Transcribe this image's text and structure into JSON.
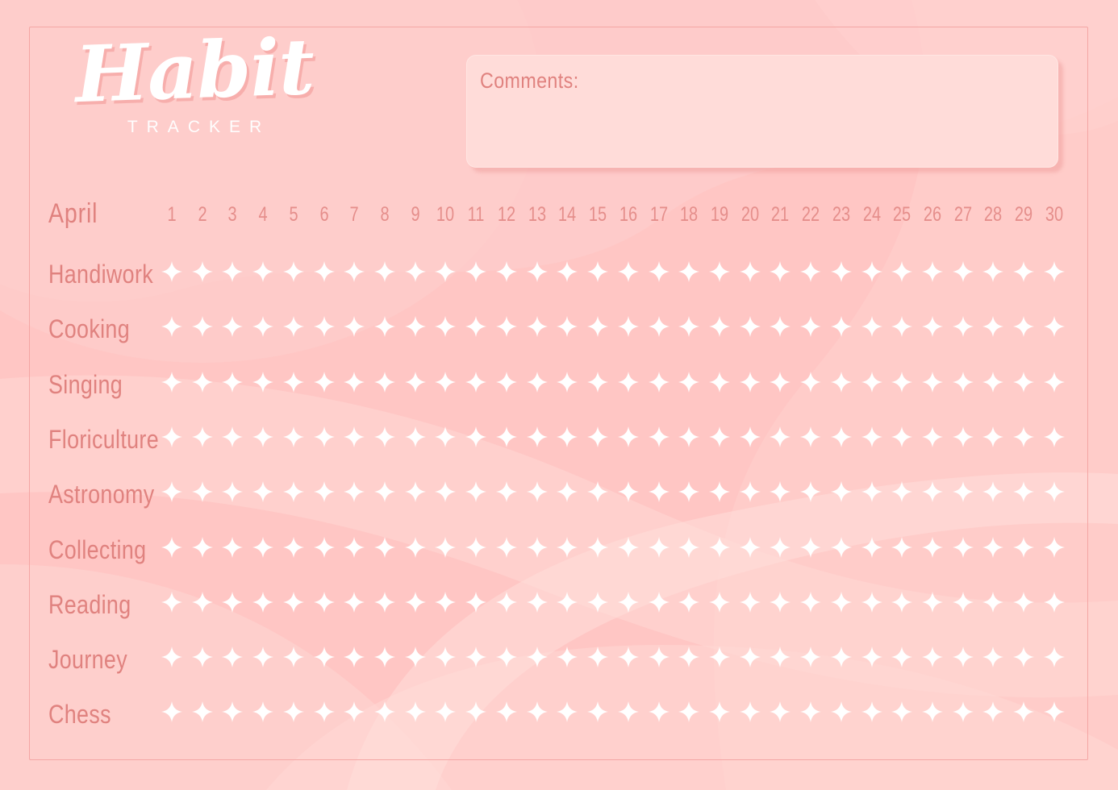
{
  "document": {
    "title_main": "Habit",
    "title_sub": "TRACKER",
    "type": "habit-tracker-printable"
  },
  "comments": {
    "label": "Comments:",
    "value": ""
  },
  "tracker": {
    "month": "April",
    "days": [
      1,
      2,
      3,
      4,
      5,
      6,
      7,
      8,
      9,
      10,
      11,
      12,
      13,
      14,
      15,
      16,
      17,
      18,
      19,
      20,
      21,
      22,
      23,
      24,
      25,
      26,
      27,
      28,
      29,
      30
    ],
    "day_count": 30,
    "marker_icon": "four-pointed-star-icon",
    "habits": [
      {
        "label": "Handiwork"
      },
      {
        "label": "Cooking"
      },
      {
        "label": "Singing"
      },
      {
        "label": "Floriculture"
      },
      {
        "label": "Astronomy"
      },
      {
        "label": "Collecting"
      },
      {
        "label": "Reading"
      },
      {
        "label": "Journey"
      },
      {
        "label": "Chess"
      }
    ]
  },
  "colors": {
    "background": "#ffc6c4",
    "background_light": "#fed2d0",
    "background_lighter": "#ffdbd8",
    "comments_fill": "#ffdcd9",
    "text_rose": "#e0827f",
    "day_number": "#e58e8b",
    "frame_border": "#f4a6a4",
    "star_white": "#ffffff",
    "title_white": "#ffffff"
  }
}
